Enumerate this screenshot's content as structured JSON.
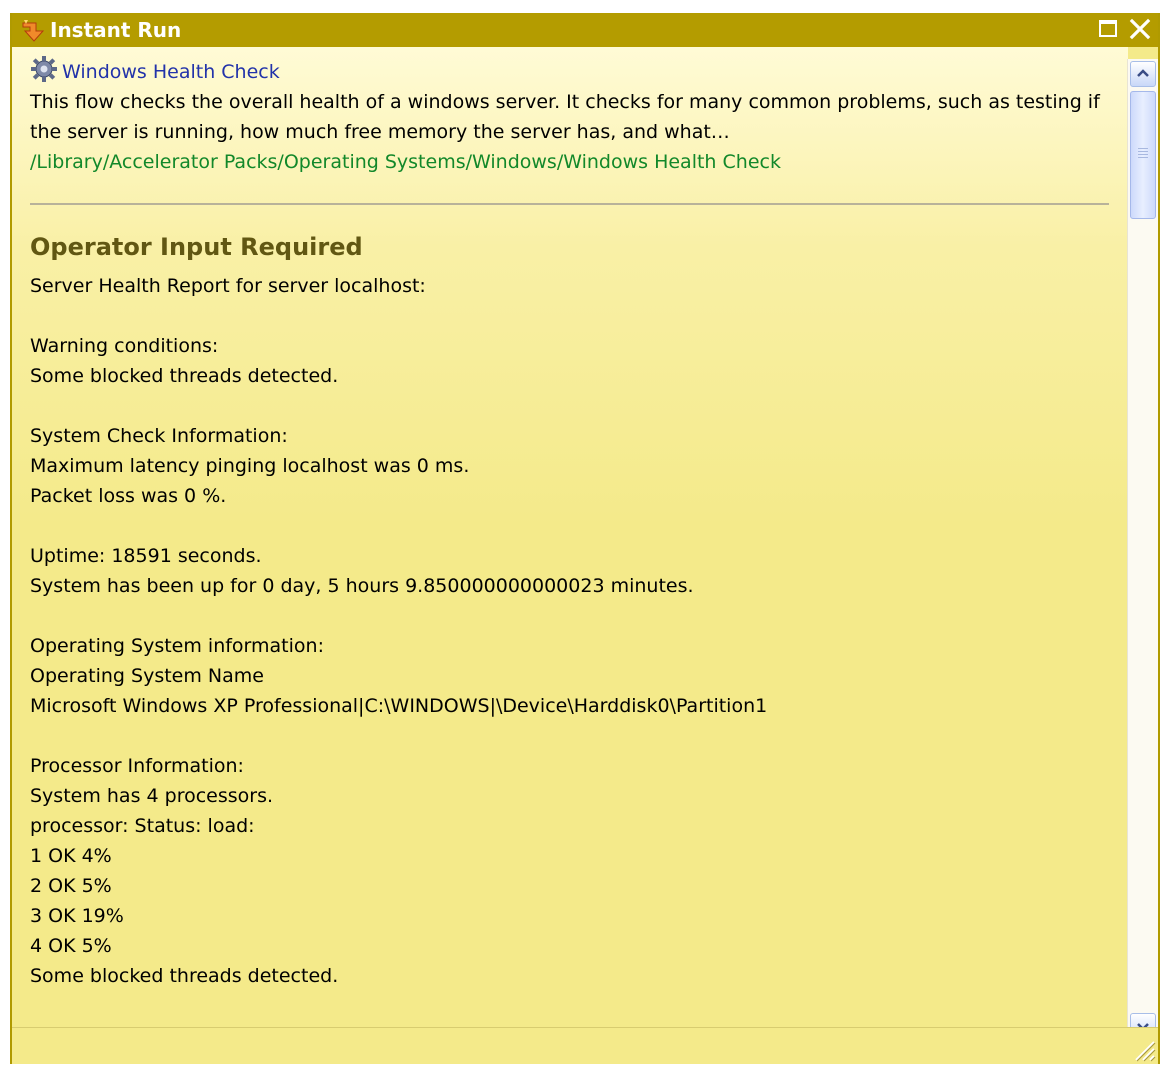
{
  "window": {
    "title": "Instant Run",
    "icon": "instant-run-icon",
    "controls": [
      "maximize-icon",
      "close-icon"
    ]
  },
  "flow": {
    "icon": "gear-icon",
    "name": "Windows Health Check",
    "description_line1": "This flow checks the overall health of a windows server. It checks for many common problems, such as testing if",
    "description_line2": "the server is running, how much free memory the server has, and what…",
    "path": "/Library/Accelerator Packs/Operating Systems/Windows/Windows Health Check"
  },
  "operator": {
    "title": "Operator Input Required",
    "report_lines": [
      "Server Health Report for server localhost:",
      "",
      "Warning conditions:",
      "Some blocked threads detected.",
      "",
      "System Check Information:",
      "Maximum latency pinging localhost was 0 ms.",
      "Packet loss was 0 %.",
      "",
      "Uptime: 18591 seconds.",
      "System has been up for 0 day, 5 hours 9.850000000000023 minutes.",
      "",
      "Operating System information:",
      "Operating System Name",
      "Microsoft Windows XP Professional|C:\\WINDOWS|\\Device\\Harddisk0\\Partition1",
      "",
      "Processor Information:",
      "System has 4 processors.",
      "processor: Status: load:",
      "1 OK 4%",
      "2 OK 5%",
      "3 OK 19%",
      "4 OK 5%",
      "Some blocked threads detected."
    ]
  },
  "colors": {
    "titlebar": "#b49c00",
    "panel": "#f4ea8a",
    "link": "#2233aa",
    "path": "#12882a",
    "heading": "#615713"
  }
}
